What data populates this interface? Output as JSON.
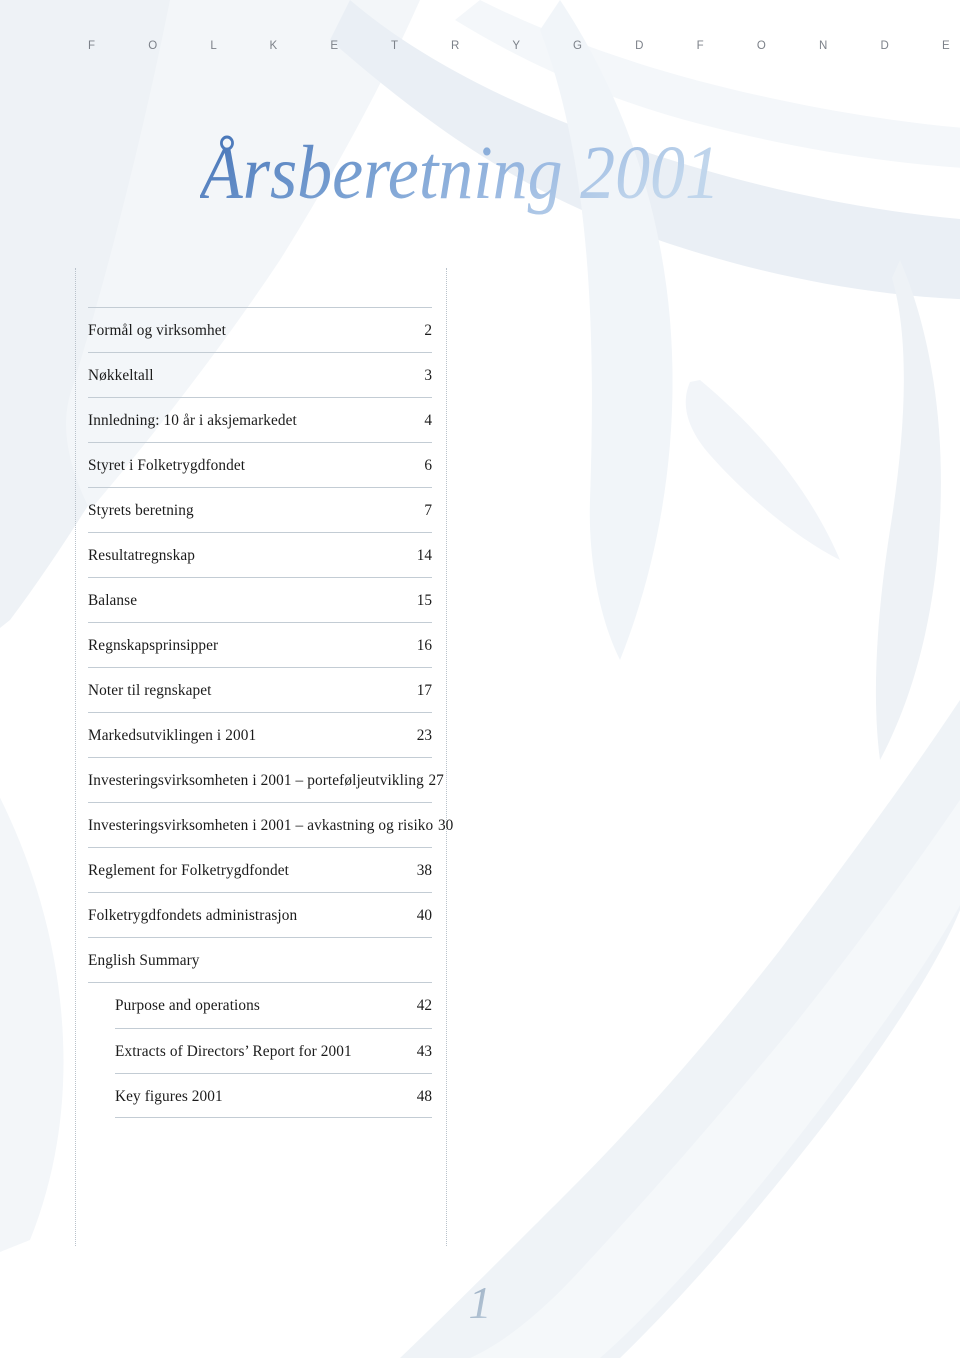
{
  "page": {
    "running_head": "F O L K E T R Y G D F O N D E T",
    "title": "Årsberetning 2001",
    "folio": "1",
    "background_color": "#ffffff",
    "wash_color": "#eef2f6",
    "rule_color": "#c3ccd4",
    "dotted_rule_color": "#b9c2cb",
    "running_head_color": "#7c8189",
    "title_gradient_from": "#4a76b8",
    "title_gradient_to": "#b3cbe8",
    "folio_color": "#9fb0c2"
  },
  "toc": {
    "entries": [
      {
        "label": "Formål og virksomhet",
        "page": "2",
        "indent": false
      },
      {
        "label": "Nøkkeltall",
        "page": "3",
        "indent": false
      },
      {
        "label": "Innledning: 10 år i aksjemarkedet",
        "page": "4",
        "indent": false
      },
      {
        "label": "Styret i Folketrygdfondet",
        "page": "6",
        "indent": false
      },
      {
        "label": "Styrets beretning",
        "page": "7",
        "indent": false
      },
      {
        "label": "Resultatregnskap",
        "page": "14",
        "indent": false
      },
      {
        "label": "Balanse",
        "page": "15",
        "indent": false
      },
      {
        "label": "Regnskapsprinsipper",
        "page": "16",
        "indent": false
      },
      {
        "label": "Noter til regnskapet",
        "page": "17",
        "indent": false
      },
      {
        "label": "Markedsutviklingen i 2001",
        "page": "23",
        "indent": false
      },
      {
        "label": "Investeringsvirksomheten i 2001 – porteføljeutvikling",
        "page": "27",
        "indent": false
      },
      {
        "label": "Investeringsvirksomheten i 2001 – avkastning og risiko",
        "page": "30",
        "indent": false
      },
      {
        "label": "Reglement for Folketrygdfondet",
        "page": "38",
        "indent": false
      },
      {
        "label": "Folketrygdfondets administrasjon",
        "page": "40",
        "indent": false
      },
      {
        "label": "English Summary",
        "page": "",
        "indent": false
      },
      {
        "label": "Purpose and operations",
        "page": "42",
        "indent": true
      },
      {
        "label": "Extracts of Directors’ Report for 2001",
        "page": "43",
        "indent": true
      },
      {
        "label": "Key figures 2001",
        "page": "48",
        "indent": true
      }
    ]
  }
}
